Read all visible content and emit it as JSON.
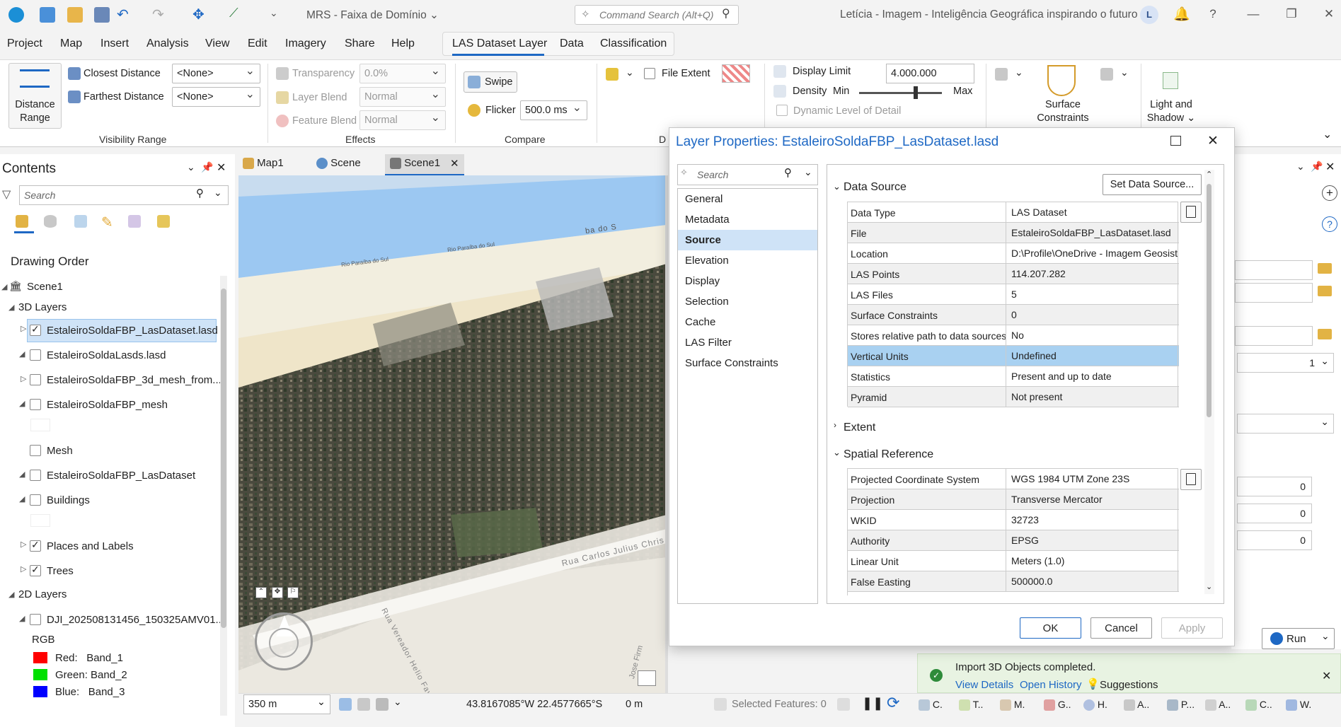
{
  "titlebar": {
    "project_name": "MRS - Faixa de Domínio",
    "command_search_placeholder": "Command Search (Alt+Q)",
    "user_text": "Letícia - Imagem - Inteligência Geográfica inspirando o futuro",
    "user_initial": "L"
  },
  "menu": {
    "items": [
      "Project",
      "Map",
      "Insert",
      "Analysis",
      "View",
      "Edit",
      "Imagery",
      "Share",
      "Help"
    ],
    "context_tabs": [
      "LAS Dataset Layer",
      "Data",
      "Classification"
    ]
  },
  "ribbon": {
    "distance_range_label": "Distance Range",
    "closest_distance_label": "Closest Distance",
    "closest_distance_value": "<None>",
    "farthest_distance_label": "Farthest Distance",
    "farthest_distance_value": "<None>",
    "visibility_range_group": "Visibility Range",
    "transparency_label": "Transparency",
    "transparency_value": "0.0%",
    "layer_blend_label": "Layer Blend",
    "layer_blend_value": "Normal",
    "feature_blend_label": "Feature Blend",
    "feature_blend_value": "Normal",
    "effects_group": "Effects",
    "swipe_label": "Swipe",
    "flicker_label": "Flicker",
    "flicker_value": "500.0",
    "flicker_unit": "ms",
    "compare_group": "Compare",
    "d_group_truncated": "D",
    "file_extent_label": "File Extent",
    "display_limit_label": "Display Limit",
    "display_limit_value": "4.000.000",
    "density_label": "Density",
    "density_min": "Min",
    "density_max": "Max",
    "density_level": 0.75,
    "dynamic_lod_label": "Dynamic Level of Detail",
    "surface_constraints_label": "Surface Constraints",
    "light_shadow_label": "Light and Shadow"
  },
  "contents": {
    "title": "Contents",
    "search_placeholder": "Search",
    "drawing_order": "Drawing Order",
    "scene": "Scene1",
    "group_3d": "3D Layers",
    "layers_3d": [
      {
        "name": "EstaleiroSoldaFBP_LasDataset.lasd",
        "checked": true
      },
      {
        "name": "EstaleiroSoldaLasds.lasd",
        "checked": false
      },
      {
        "name": "EstaleiroSoldaFBP_3d_mesh_from...",
        "checked": false
      },
      {
        "name": "EstaleiroSoldaFBP_mesh",
        "checked": false
      },
      {
        "name": "Mesh",
        "checked": false
      },
      {
        "name": "EstaleiroSoldaFBP_LasDataset",
        "checked": false
      },
      {
        "name": "Buildings",
        "checked": false
      },
      {
        "name": "Places and Labels",
        "checked": true
      },
      {
        "name": "Trees",
        "checked": true
      }
    ],
    "group_2d": "2D Layers",
    "layer_2d": "DJI_202508131456_150325AMV01...",
    "rgb_label": "RGB",
    "bands": [
      {
        "label": "Red:",
        "band": "Band_1",
        "color": "#ff0000"
      },
      {
        "label": "Green:",
        "band": "Band_2",
        "color": "#00e000"
      },
      {
        "label": "Blue:",
        "band": "Band_3",
        "color": "#0000ff"
      }
    ]
  },
  "view_tabs": [
    "Map1",
    "Scene",
    "Scene1"
  ],
  "map": {
    "labels": [
      "ba do S",
      "Rio Paraíba do Sul",
      "Rio Paraíba do Sul",
      "Rua Carlos Julius Chris",
      "Rua Vereador Helio Favieri",
      "Jose Firm"
    ]
  },
  "status_bar": {
    "scale": "350 m",
    "coordinates": "43.8167085°W 22.4577665°S",
    "elevation": "0 m",
    "selected_features": "Selected Features: 0"
  },
  "dialog": {
    "title": "Layer Properties: EstaleiroSoldaFBP_LasDataset.lasd",
    "nav_search_placeholder": "Search",
    "nav_items": [
      "General",
      "Metadata",
      "Source",
      "Elevation",
      "Display",
      "Selection",
      "Cache",
      "LAS Filter",
      "Surface Constraints"
    ],
    "selected_nav": "Source",
    "data_source_header": "Data Source",
    "set_data_source_button": "Set Data Source...",
    "data_source_rows": [
      {
        "key": "Data Type",
        "value": "LAS Dataset"
      },
      {
        "key": "File",
        "value": "EstaleiroSoldaFBP_LasDataset.lasd"
      },
      {
        "key": "Location",
        "value": "D:\\Profile\\OneDrive - Imagem Geosist"
      },
      {
        "key": "LAS Points",
        "value": "114.207.282"
      },
      {
        "key": "LAS Files",
        "value": "5"
      },
      {
        "key": "Surface Constraints",
        "value": "0"
      },
      {
        "key": "Stores relative path to data sources",
        "value": "No"
      },
      {
        "key": "Vertical Units",
        "value": "Undefined"
      },
      {
        "key": "Statistics",
        "value": "Present and up to date"
      },
      {
        "key": "Pyramid",
        "value": "Not present"
      }
    ],
    "extent_header": "Extent",
    "spatial_ref_header": "Spatial Reference",
    "spatial_ref_rows": [
      {
        "key": "Projected Coordinate System",
        "value": "WGS 1984 UTM Zone 23S"
      },
      {
        "key": "Projection",
        "value": "Transverse Mercator"
      },
      {
        "key": "WKID",
        "value": "32723"
      },
      {
        "key": "Authority",
        "value": "EPSG"
      },
      {
        "key": "Linear Unit",
        "value": "Meters (1.0)"
      },
      {
        "key": "False Easting",
        "value": "500000.0"
      }
    ],
    "ok_button": "OK",
    "cancel_button": "Cancel",
    "apply_button": "Apply"
  },
  "right_pane": {
    "field_value_1": "1",
    "zero_1": "0",
    "zero_2": "0",
    "zero_3": "0",
    "run_button": "Run"
  },
  "notification": {
    "message": "Import 3D Objects completed.",
    "view_details": "View Details",
    "open_history": "Open History",
    "suggestions": "Suggestions"
  },
  "bottom_toolbar": [
    "C.",
    "T..",
    "M.",
    "G..",
    "H.",
    "A..",
    "P...",
    "A..",
    "C..",
    "W."
  ],
  "colors": {
    "accent": "#1e68c4",
    "selection": "#cfe3f7",
    "highlight_row": "#a9d1f1",
    "toast_bg": "#e8f3e2"
  }
}
